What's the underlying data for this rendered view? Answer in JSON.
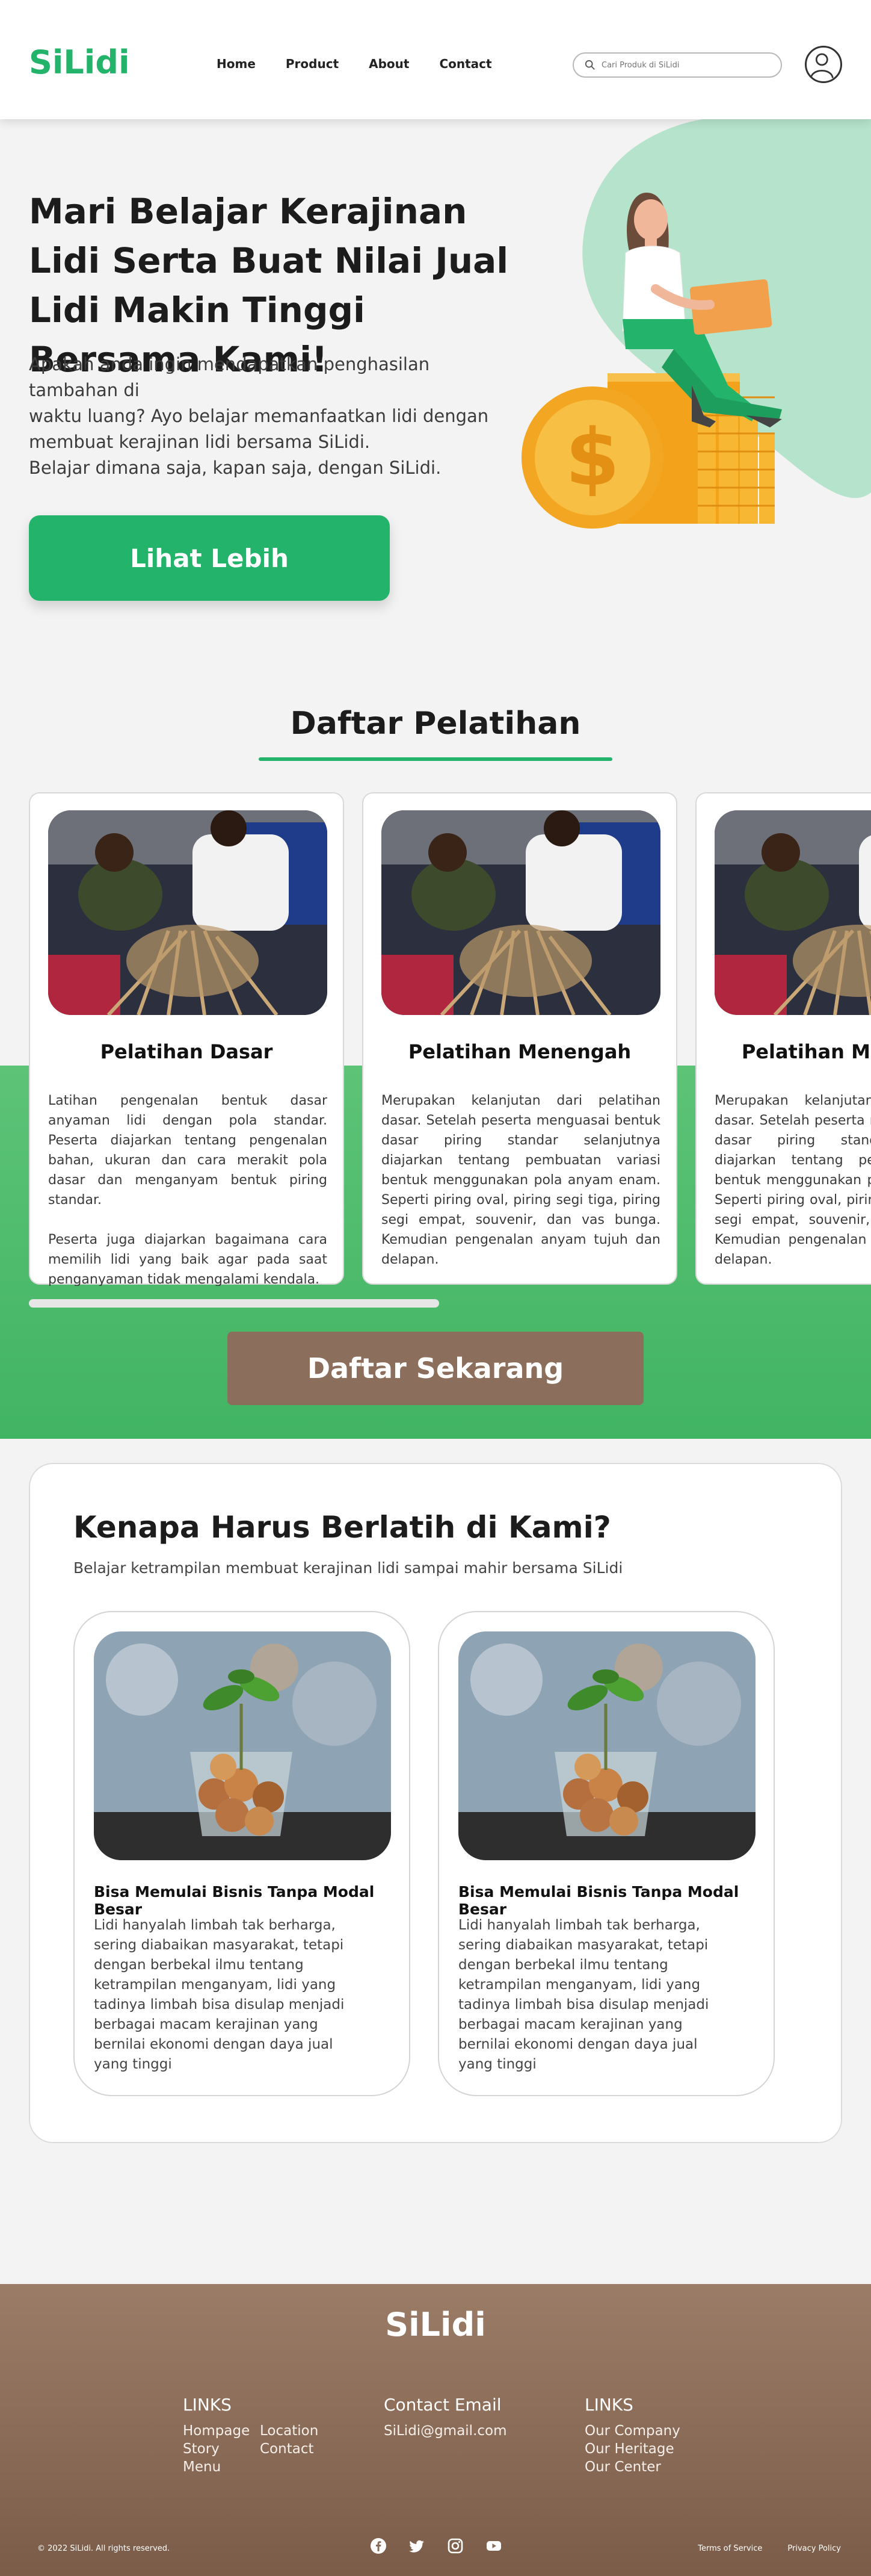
{
  "header": {
    "logo": "SiLidi",
    "nav": [
      "Home",
      "Product",
      "About",
      "Contact"
    ],
    "search_placeholder": "Cari Produk di SiLidi"
  },
  "hero": {
    "title": "Mari Belajar Kerajinan Lidi Serta Buat Nilai Jual Lidi Makin Tinggi Bersama Kami!",
    "description_lines": [
      "Apakah anda ingin mendapatkan penghasilan tambahan di",
      "waktu luang? Ayo belajar memanfaatkan lidi dengan",
      "membuat kerajinan lidi bersama SiLidi.",
      "Belajar dimana saja, kapan saja, dengan SiLidi."
    ],
    "button": "Lihat Lebih"
  },
  "training": {
    "title": "Daftar Pelatihan",
    "cards": [
      {
        "title": "Pelatihan Dasar",
        "text": "Latihan pengenalan bentuk dasar anyaman lidi dengan pola standar. Peserta diajarkan tentang pengenalan bahan, ukuran dan cara merakit pola dasar dan menganyam bentuk piring standar.\n\nPeserta juga diajarkan bagaimana cara memilih lidi yang baik agar pada saat penganyaman tidak mengalami kendala."
      },
      {
        "title": "Pelatihan Menengah",
        "text": "Merupakan kelanjutan dari pelatihan dasar. Setelah peserta menguasai bentuk dasar piring standar selanjutnya diajarkan tentang pembuatan variasi bentuk menggunakan pola anyam enam. Seperti piring oval, piring segi tiga, piring segi empat, souvenir, dan vas bunga. Kemudian pengenalan anyam tujuh dan delapan."
      },
      {
        "title": "Pelatihan Menengah",
        "text": "Merupakan kelanjutan dari pelatihan dasar. Setelah peserta menguasai bentuk dasar piring standar selanjutnya diajarkan tentang pembuatan variasi bentuk menggunakan pola anyam enam. Seperti piring oval, piring segi tiga, piring segi empat, souvenir, dan vas bunga. Kemudian pengenalan anyam tujuh dan delapan."
      }
    ],
    "register_button": "Daftar Sekarang"
  },
  "why": {
    "title": "Kenapa Harus Berlatih di Kami?",
    "subtitle": "Belajar ketrampilan membuat kerajinan lidi sampai mahir bersama SiLidi",
    "cards": [
      {
        "title": "Bisa Memulai Bisnis Tanpa Modal Besar",
        "text": "Lidi hanyalah limbah tak berharga, sering diabaikan masyarakat, tetapi dengan berbekal ilmu tentang ketrampilan menganyam, lidi yang tadinya limbah bisa disulap menjadi berbagai macam kerajinan yang bernilai ekonomi dengan daya jual yang tinggi"
      },
      {
        "title": "Bisa Memulai Bisnis Tanpa Modal Besar",
        "text": "Lidi hanyalah limbah tak berharga, sering diabaikan masyarakat, tetapi dengan berbekal ilmu tentang ketrampilan menganyam, lidi yang tadinya limbah bisa disulap menjadi berbagai macam kerajinan yang bernilai ekonomi dengan daya jual yang tinggi"
      }
    ]
  },
  "footer": {
    "logo": "SiLidi",
    "links1_title": "LINKS",
    "links1": [
      "Hompage",
      "Location",
      "Story",
      "Contact",
      "Menu"
    ],
    "contact_title": "Contact Email",
    "contact_email": "SiLidi@gmail.com",
    "links2_title": "LINKS",
    "links2": [
      "Our Company",
      "Our Heritage",
      "Our Center"
    ],
    "copyright": "© 2022 SiLidi. All rights reserved.",
    "social": [
      "facebook-icon",
      "twitter-icon",
      "instagram-icon",
      "youtube-icon"
    ],
    "legal": [
      "Terms of Service",
      "Privacy Policy"
    ]
  },
  "colors": {
    "brand_green": "#24b36b",
    "brown": "#8b6e5c"
  }
}
